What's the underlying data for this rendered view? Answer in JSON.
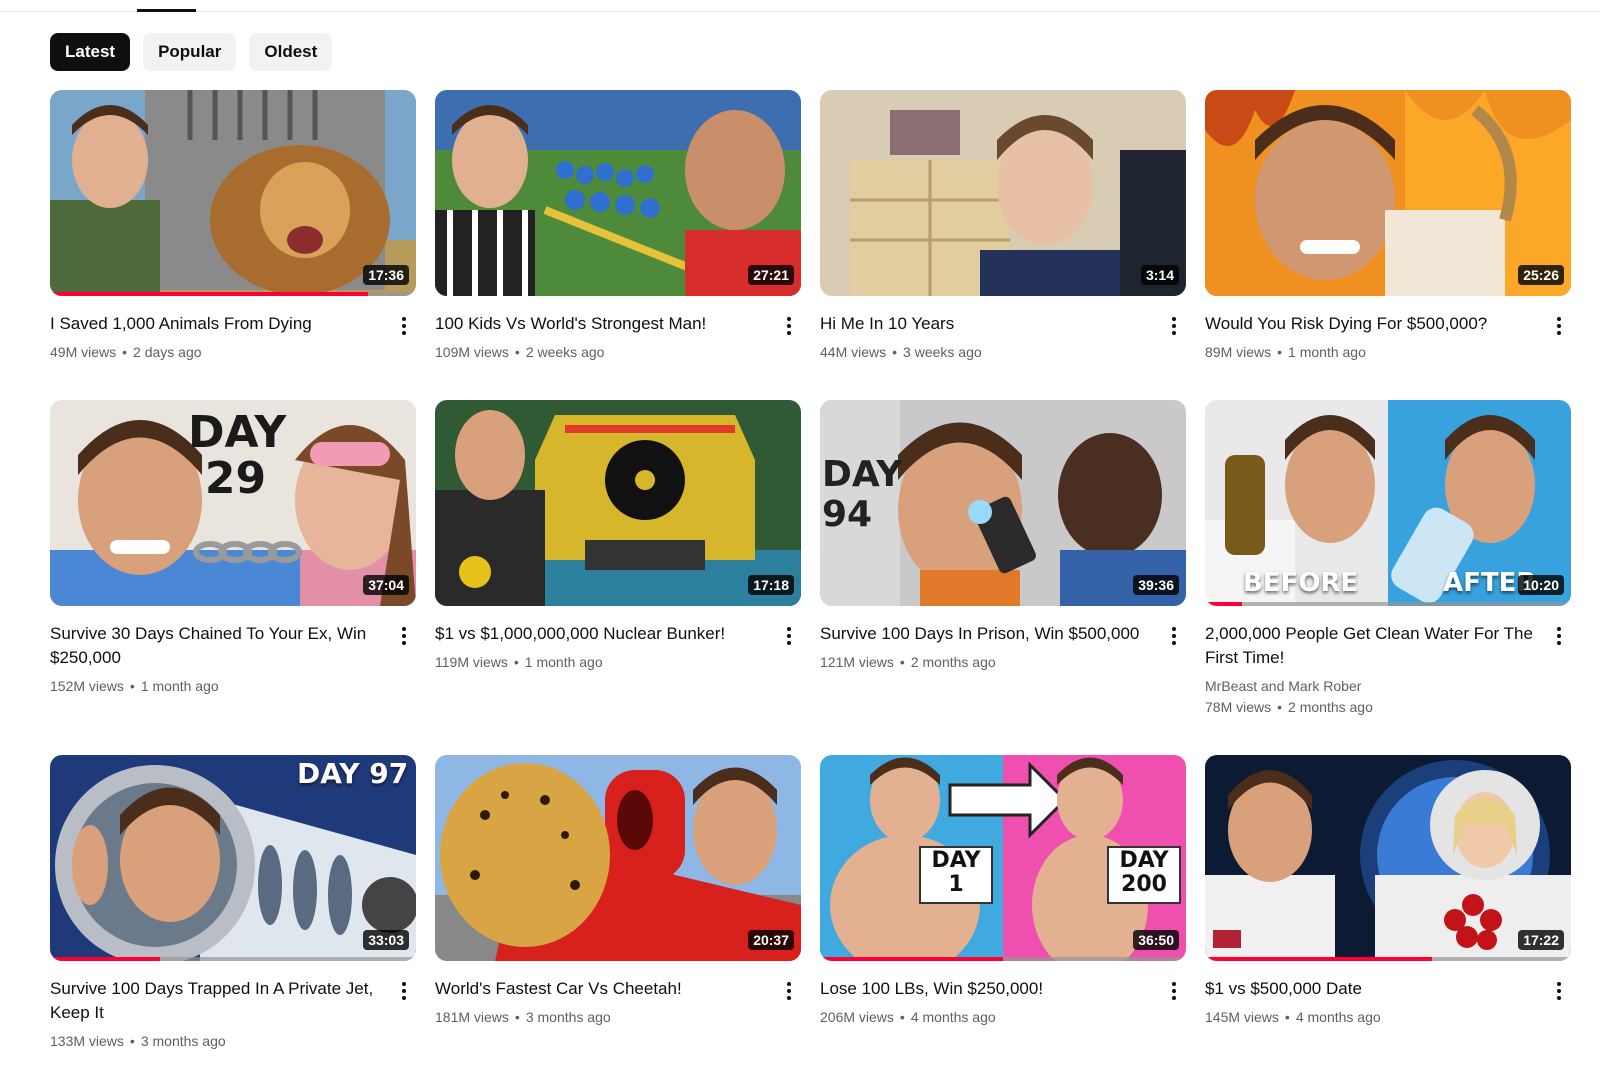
{
  "filters": {
    "chips": [
      {
        "label": "Latest",
        "active": true
      },
      {
        "label": "Popular",
        "active": false
      },
      {
        "label": "Oldest",
        "active": false
      }
    ]
  },
  "videos": [
    {
      "title": "I Saved 1,000 Animals From Dying",
      "views": "49M views",
      "age": "2 days ago",
      "duration": "17:36",
      "watched": 0.87
    },
    {
      "title": "100 Kids Vs World's Strongest Man!",
      "views": "109M views",
      "age": "2 weeks ago",
      "duration": "27:21",
      "watched": 0
    },
    {
      "title": "Hi Me In 10 Years",
      "views": "44M views",
      "age": "3 weeks ago",
      "duration": "3:14",
      "watched": 0
    },
    {
      "title": "Would You Risk Dying For $500,000?",
      "views": "89M views",
      "age": "1 month ago",
      "duration": "25:26",
      "watched": 0
    },
    {
      "title": "Survive 30 Days Chained To Your Ex, Win $250,000",
      "views": "152M views",
      "age": "1 month ago",
      "duration": "37:04",
      "watched": 0
    },
    {
      "title": "$1 vs $1,000,000,000 Nuclear Bunker!",
      "views": "119M views",
      "age": "1 month ago",
      "duration": "17:18",
      "watched": 0
    },
    {
      "title": "Survive 100 Days In Prison, Win $500,000",
      "views": "121M views",
      "age": "2 months ago",
      "duration": "39:36",
      "watched": 0
    },
    {
      "title": "2,000,000 People Get Clean Water For The First Time!",
      "channel": "MrBeast and Mark Rober",
      "views": "78M views",
      "age": "2 months ago",
      "duration": "10:20",
      "watched": 0.1
    },
    {
      "title": "Survive 100 Days Trapped In A Private Jet, Keep It",
      "views": "133M views",
      "age": "3 months ago",
      "duration": "33:03",
      "watched": 0.3
    },
    {
      "title": "World's Fastest Car Vs Cheetah!",
      "views": "181M views",
      "age": "3 months ago",
      "duration": "20:37",
      "watched": 0
    },
    {
      "title": "Lose 100 LBs, Win $250,000!",
      "views": "206M views",
      "age": "4 months ago",
      "duration": "36:50",
      "watched": 0.5
    },
    {
      "title": "$1 vs $500,000 Date",
      "views": "145M views",
      "age": "4 months ago",
      "duration": "17:22",
      "watched": 0.62
    }
  ],
  "thumb_text": {
    "day29": "DAY 29",
    "day94": "DAY 94",
    "before": "BEFORE",
    "after": "AFTER",
    "day97": "DAY 97",
    "day1": "DAY 1",
    "day200": "DAY 200"
  },
  "colors": {
    "accent": "#ff0033",
    "chip_active": "#0f0f0f",
    "chip": "#f2f2f2",
    "meta_text": "#606060"
  }
}
